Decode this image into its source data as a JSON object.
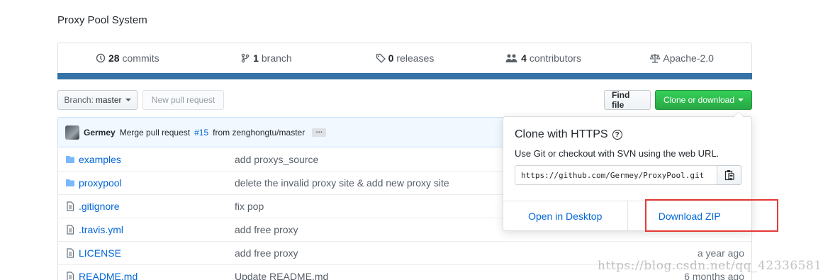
{
  "repo": {
    "description": "Proxy Pool System"
  },
  "stats": [
    {
      "icon": "history-icon",
      "count": "28",
      "label": "commits"
    },
    {
      "icon": "branch-icon",
      "count": "1",
      "label": "branch"
    },
    {
      "icon": "tag-icon",
      "count": "0",
      "label": "releases"
    },
    {
      "icon": "people-icon",
      "count": "4",
      "label": "contributors"
    },
    {
      "icon": "law-icon",
      "count": "",
      "label": "Apache-2.0"
    }
  ],
  "language_bar_color": "#3572A5",
  "toolbar": {
    "branch_prefix": "Branch:",
    "branch_name": "master",
    "new_pull_request": "New pull request",
    "find_file": "Find file",
    "clone_or_download": "Clone or download"
  },
  "commit": {
    "author": "Germey",
    "message": "Merge pull request",
    "pr_link": "#15",
    "message_suffix": "from zenghongtu/master",
    "ellipsis": "…"
  },
  "files": [
    {
      "type": "folder",
      "name": "examples",
      "message": "add proxys_source",
      "age": ""
    },
    {
      "type": "folder",
      "name": "proxypool",
      "message": "delete the invalid proxy site & add new proxy site",
      "age": ""
    },
    {
      "type": "file",
      "name": ".gitignore",
      "message": "fix pop",
      "age": ""
    },
    {
      "type": "file",
      "name": ".travis.yml",
      "message": "add free proxy",
      "age": ""
    },
    {
      "type": "file",
      "name": "LICENSE",
      "message": "add free proxy",
      "age": "a year ago"
    },
    {
      "type": "file",
      "name": "README.md",
      "message": "Update README.md",
      "age": "6 months ago"
    }
  ],
  "clone_dropdown": {
    "title": "Clone with HTTPS",
    "help_glyph": "?",
    "hint": "Use Git or checkout with SVN using the web URL.",
    "url": "https://github.com/Germey/ProxyPool.git",
    "open_desktop": "Open in Desktop",
    "download_zip": "Download ZIP"
  },
  "watermark": "https://blog.csdn.net/qq_42336581",
  "colors": {
    "link": "#0366d6",
    "clone_green": "#28a745",
    "highlight_red": "#e53935"
  }
}
